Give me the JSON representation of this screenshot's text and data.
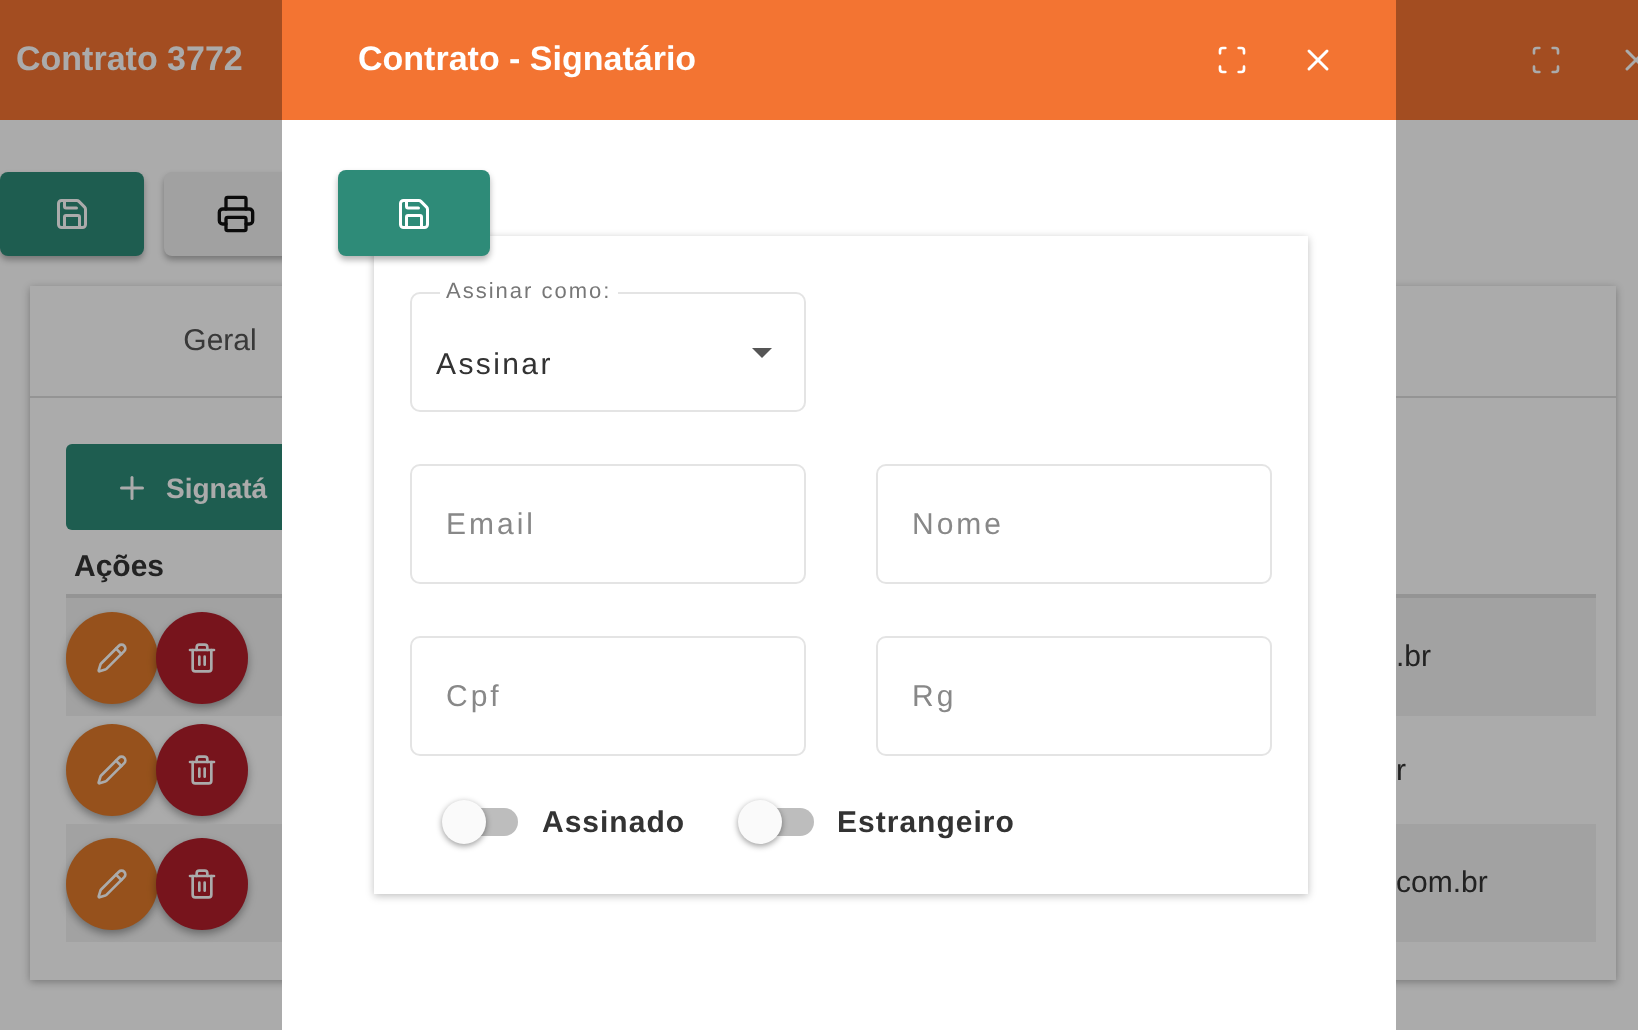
{
  "background_window": {
    "title": "Contrato 3772",
    "tabs": [
      {
        "label": "Geral"
      }
    ],
    "add_button": "Signatá",
    "table": {
      "columns": [
        "Ações"
      ],
      "rows": [
        {
          "column_2": ".br"
        },
        {
          "column_2": "r"
        },
        {
          "column_2": "com.br"
        }
      ]
    }
  },
  "dialog": {
    "title": "Contrato - Signatário",
    "select": {
      "label": "Assinar como:",
      "value": "Assinar"
    },
    "fields": [
      {
        "placeholder": "Email"
      },
      {
        "placeholder": "Nome"
      },
      {
        "placeholder": "Cpf"
      },
      {
        "placeholder": "Rg"
      }
    ],
    "switches": [
      {
        "label": "Assinado",
        "on": false
      },
      {
        "label": "Estrangeiro",
        "on": false
      }
    ]
  }
}
